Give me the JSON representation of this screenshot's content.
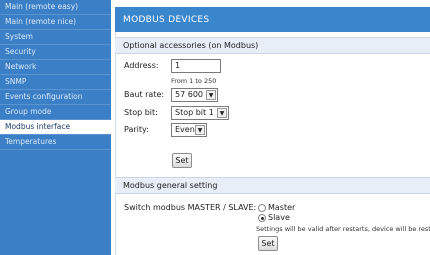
{
  "sidebar": {
    "items": [
      {
        "label": "Main (remote easy)",
        "active": false
      },
      {
        "label": "Main (remote nice)",
        "active": false
      },
      {
        "label": "System",
        "active": false
      },
      {
        "label": "Security",
        "active": false
      },
      {
        "label": "Network",
        "active": false
      },
      {
        "label": "SNMP",
        "active": false
      },
      {
        "label": "Events configuration",
        "active": false
      },
      {
        "label": "Group mode",
        "active": false
      },
      {
        "label": "Modbus interface",
        "active": true
      },
      {
        "label": "Temperatures",
        "active": false
      }
    ]
  },
  "header": {
    "title": "MODBUS DEVICES"
  },
  "accessories": {
    "title": "Optional accessories (on Modbus)",
    "address_label": "Address:",
    "address_value": "1",
    "address_hint": "From 1 to 250",
    "baud_label": "Baut rate:",
    "baud_value": "57 600",
    "stop_label": "Stop bit:",
    "stop_value": "Stop bit 1",
    "parity_label": "Parity:",
    "parity_value": "Even",
    "set_label": "Set"
  },
  "general": {
    "title": "Modbus general setting",
    "switch_label": "Switch modbus MASTER / SLAVE:",
    "master_label": "Master",
    "slave_label": "Slave",
    "selected": "Slave",
    "note": "Settings will be valid after restarts, device will be restarted",
    "set_label": "Set"
  },
  "colors": {
    "sidebar_bg": "#3b7fc6",
    "header_bg": "#3a86cc",
    "section_bg": "#e7eef7"
  }
}
